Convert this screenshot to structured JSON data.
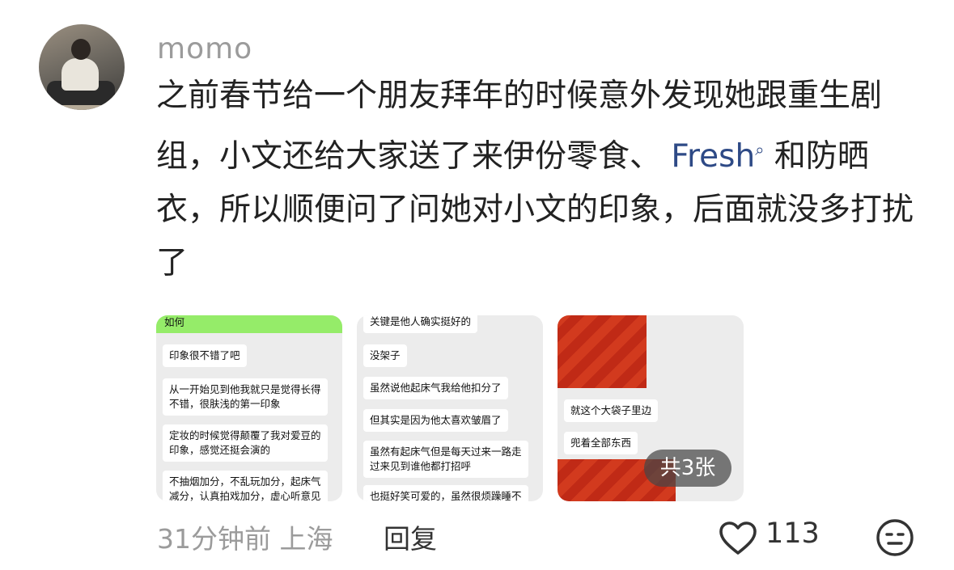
{
  "comment": {
    "username": "momo",
    "text_before_link": "之前春节给一个朋友拜年的时候意外发现她跟重生剧组，小文还给大家送了来伊份零食、 ",
    "link_text": "Fresh",
    "text_after_link": " 和防晒衣，所以顺便问了问她对小文的印象，后面就没多打扰了",
    "time": "31分钟前",
    "location": "上海",
    "reply_label": "回复",
    "like_count": "113",
    "image_count_label": "共3张"
  },
  "images": {
    "image1": {
      "top_bar": "如何",
      "bubbles": [
        "印象很不错了吧",
        "从一开始见到他我就只是觉得长得\n不错，很肤浅的第一印象",
        "定妆的时候觉得颠覆了我对爱豆的\n印象，感觉还挺会演的",
        "不抽烟加分，不乱玩加分，起床气\n减分，认真拍戏加分，虚心听意见"
      ]
    },
    "image2": {
      "bubbles": [
        "关键是他人确实挺好的",
        "没架子",
        "虽然说他起床气我给他扣分了",
        "但其实是因为他太喜欢皱眉了",
        "虽然有起床气但是每天过来一路走\n过来见到谁他都打招呼",
        "也挺好笑可爱的，虽然很烦躁睡不"
      ]
    },
    "image3": {
      "bubbles": [
        "就这个大袋子里边",
        "兜着全部东西"
      ]
    }
  },
  "colors": {
    "username": "#9b9b9b",
    "link": "#2e4a86",
    "wechat_green": "#95ec69",
    "bag_red": "#d23a1e"
  },
  "icons": {
    "like": "heart-outline-icon",
    "reaction": "neutral-face-icon",
    "link_search": "search-icon"
  }
}
